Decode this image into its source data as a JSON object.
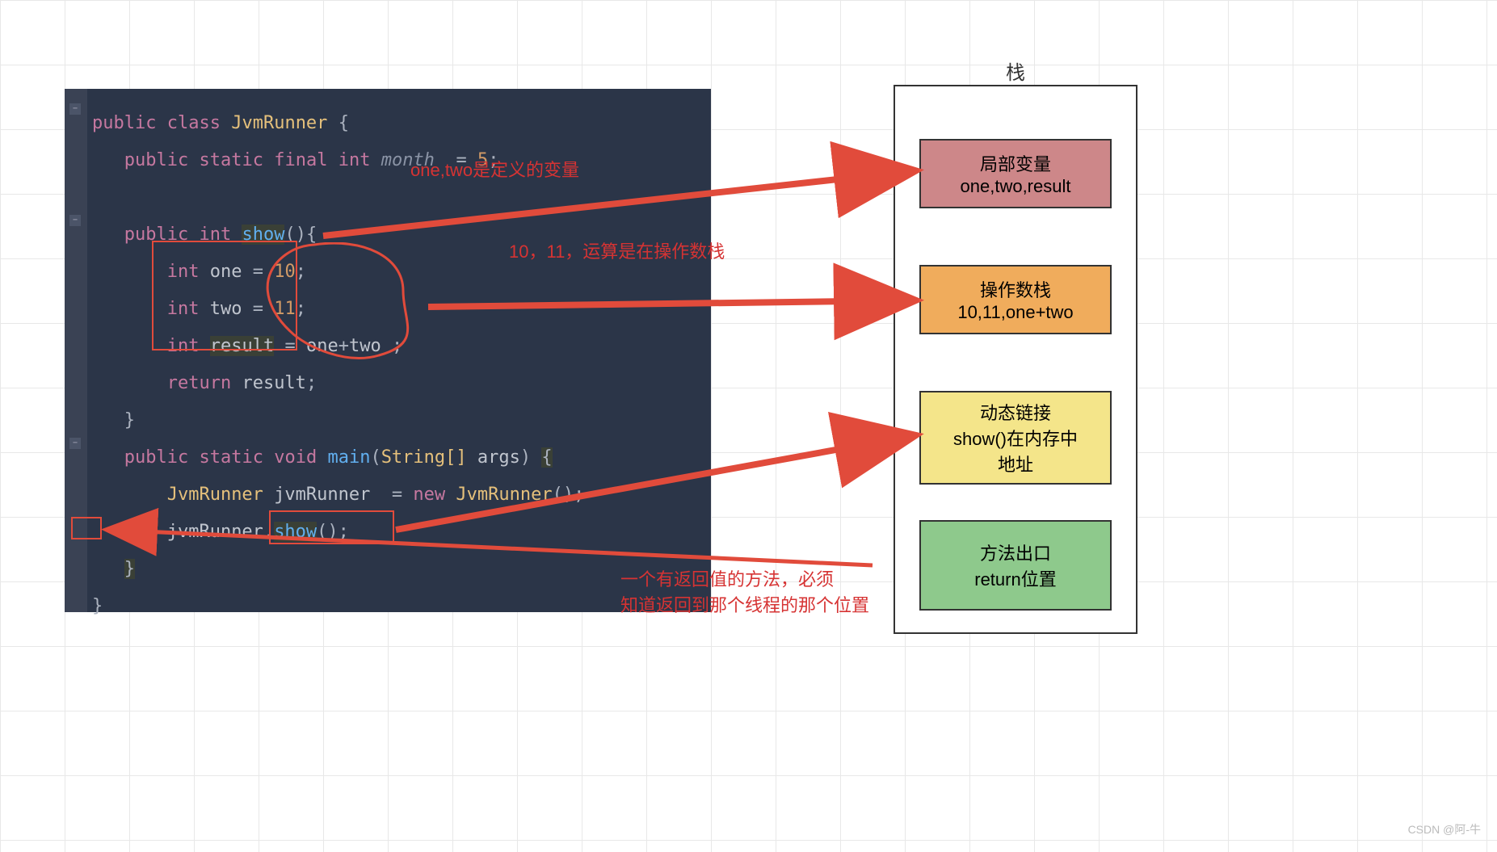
{
  "code": {
    "tokens": {
      "public": "public",
      "class": "class",
      "static": "static",
      "final": "final",
      "int": "int",
      "void": "void",
      "new": "new",
      "return": "return",
      "className": "JvmRunner",
      "monthField": "month",
      "monthVal": "5",
      "showFn": "show",
      "one": "one",
      "two": "two",
      "result": "result",
      "ten": "10",
      "eleven": "11",
      "mainFn": "main",
      "stringArr": "String[]",
      "args": "args",
      "jvmVar": "jvmRunner"
    }
  },
  "stack": {
    "title": "栈",
    "localVars": {
      "line1": "局部变量",
      "line2": "one,two,result"
    },
    "operand": {
      "line1": "操作数栈",
      "line2": "10,11,one+two"
    },
    "dynLink": {
      "line1": "动态链接",
      "line2": "show()在内存中",
      "line3": "地址"
    },
    "exit": {
      "line1": "方法出口",
      "line2": "return位置"
    }
  },
  "annotations": {
    "a1": "one,two是定义的变量",
    "a2": "10，11，运算是在操作数栈",
    "a3": "一个有返回值的方法，必须\n知道返回到那个线程的那个位置"
  },
  "watermark": "CSDN @阿-牛"
}
